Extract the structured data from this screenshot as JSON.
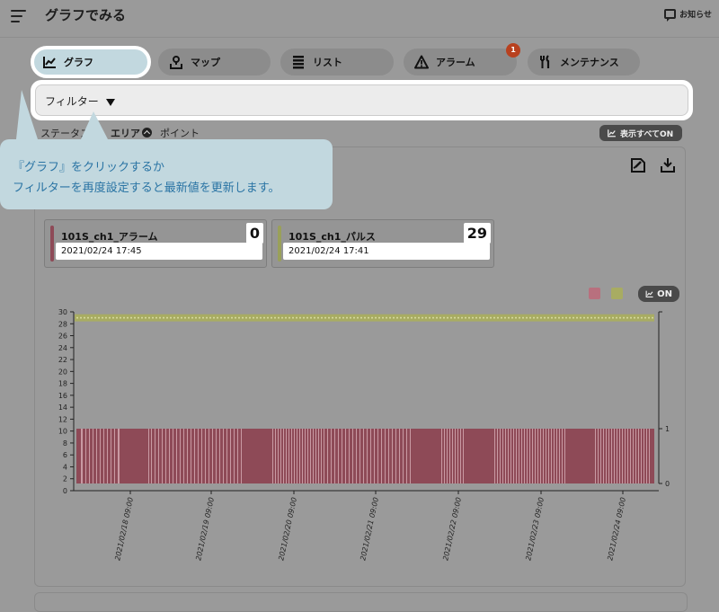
{
  "header": {
    "title": "グラフでみる",
    "notice_label": "お知らせ"
  },
  "tabs": [
    {
      "label": "グラフ",
      "icon": "line-chart-icon",
      "active": true
    },
    {
      "label": "マップ",
      "icon": "map-pin-icon",
      "active": false
    },
    {
      "label": "リスト",
      "icon": "list-icon",
      "active": false
    },
    {
      "label": "アラーム",
      "icon": "warning-icon",
      "active": false,
      "badge": "1"
    },
    {
      "label": "メンテナンス",
      "icon": "tools-icon",
      "active": false
    }
  ],
  "filter": {
    "label": "フィルター"
  },
  "subtabs": {
    "status": "ステータス",
    "area": "エリア",
    "point": "ポイント"
  },
  "show_all_label": "表示すべてON",
  "tooltip": {
    "line1": "『グラフ』をクリックするか",
    "line2": "フィルターを再度設定すると最新値を更新します。"
  },
  "cards": [
    {
      "name": "101S_ch1_アラーム",
      "value": "0",
      "date": "2021/02/24 17:45",
      "color": "#8e4a57"
    },
    {
      "name": "101S_ch1_パルス",
      "value": "29",
      "date": "2021/02/24 17:41",
      "color": "#9aa05a"
    }
  ],
  "chart_on_label": "ON",
  "chart_data": {
    "type": "bar",
    "left_axis": {
      "min": 0,
      "max": 30,
      "ticks": [
        0,
        2,
        4,
        6,
        8,
        10,
        12,
        14,
        16,
        18,
        20,
        22,
        24,
        26,
        28,
        30
      ]
    },
    "right_axis": {
      "min": 0,
      "max": 1,
      "ticks": [
        0,
        1
      ]
    },
    "x_labels": [
      "2021/02/18 09:00",
      "2021/02/19 09:00",
      "2021/02/20 09:00",
      "2021/02/21 09:00",
      "2021/02/22 09:00",
      "2021/02/23 09:00",
      "2021/02/24 09:00"
    ],
    "series": [
      {
        "axis": "right",
        "color": "#8e4a57",
        "level": 1
      },
      {
        "axis": "left",
        "color": "#a8ac62",
        "level": 29
      }
    ]
  }
}
